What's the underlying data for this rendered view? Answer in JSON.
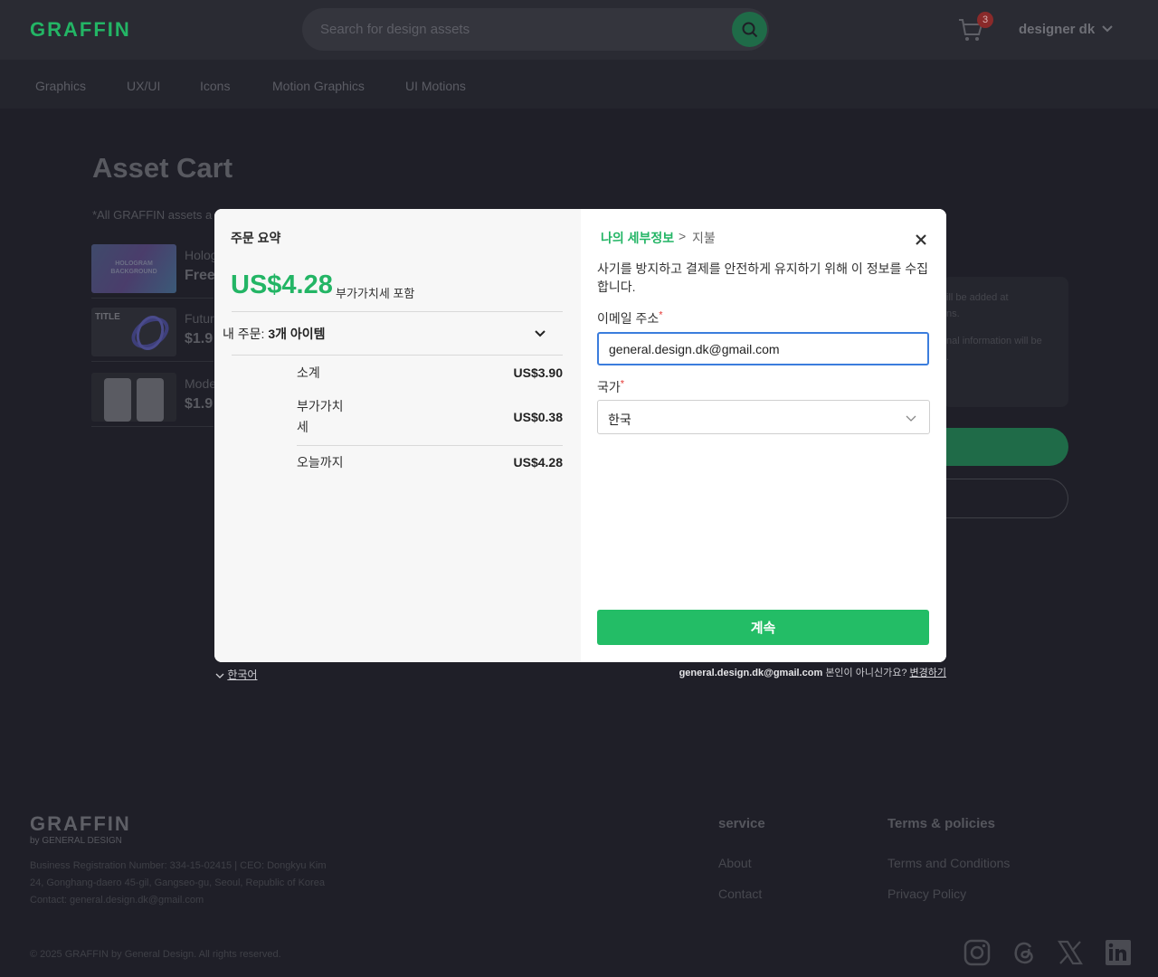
{
  "header": {
    "logo": "GRAFFIN",
    "search_placeholder": "Search for design assets",
    "cart_count": "3",
    "user_name": "designer dk"
  },
  "nav": [
    "Graphics",
    "UX/UI",
    "Icons",
    "Motion Graphics",
    "UI Motions"
  ],
  "page": {
    "title": "Asset Cart",
    "note": "*All GRAFFIN assets a",
    "items": [
      {
        "name": "Holog",
        "price": "Free",
        "thumb_text": "HOLOGRAM BACKGROUND"
      },
      {
        "name": "Futur",
        "price": "$1.9",
        "thumb_text": "TITLE"
      },
      {
        "name": "Mode",
        "price": "$1.9",
        "thumb_text": ""
      }
    ],
    "side_text": [
      "ill be added at",
      "ns.",
      "nal information will be",
      "."
    ]
  },
  "modal": {
    "summary": {
      "title": "주문 요약",
      "total": "US$4.28",
      "vat_note": "부가가치세 포함",
      "orders_label": "내 주문:",
      "orders_count": "3개 아이템",
      "rows": [
        {
          "label": "소계",
          "value": "US$3.90"
        },
        {
          "label": "부가가치\n세",
          "value": "US$0.38"
        },
        {
          "label": "오늘까지",
          "value": "US$4.28"
        }
      ]
    },
    "details": {
      "breadcrumb_active": "나의 세부정보",
      "breadcrumb_sep": ">",
      "breadcrumb_next": "지불",
      "description": "사기를 방지하고 결제를 안전하게 유지하기 위해 이 정보를 수집합니다.",
      "email_label": "이메일 주소",
      "email_value": "general.design.dk@gmail.com",
      "country_label": "국가",
      "country_value": "한국",
      "required_mark": "*",
      "continue_label": "계속"
    }
  },
  "below_modal": {
    "language": "한국어",
    "account_email": "general.design.dk@gmail.com",
    "account_question": "본인이 아니신가요?",
    "change_link": "변경하기"
  },
  "footer": {
    "logo": "GRAFFIN",
    "logo_sub": "by GENERAL DESIGN",
    "info": [
      "Business Registration Number: 334-15-02415 | CEO: Dongkyu Kim",
      "24, Gonghang-daero 45-gil, Gangseo-gu, Seoul, Republic of Korea",
      "Contact: general.design.dk@gmail.com"
    ],
    "copyright": "© 2025 GRAFFIN by General Design. All rights reserved.",
    "service_head": "service",
    "service_links": [
      "About",
      "Contact"
    ],
    "terms_head": "Terms & policies",
    "terms_links": [
      "Terms and Conditions",
      "Privacy Policy"
    ]
  },
  "colors": {
    "accent": "#23b565",
    "background": "#1f1f28",
    "focus": "#3b7ddd"
  }
}
